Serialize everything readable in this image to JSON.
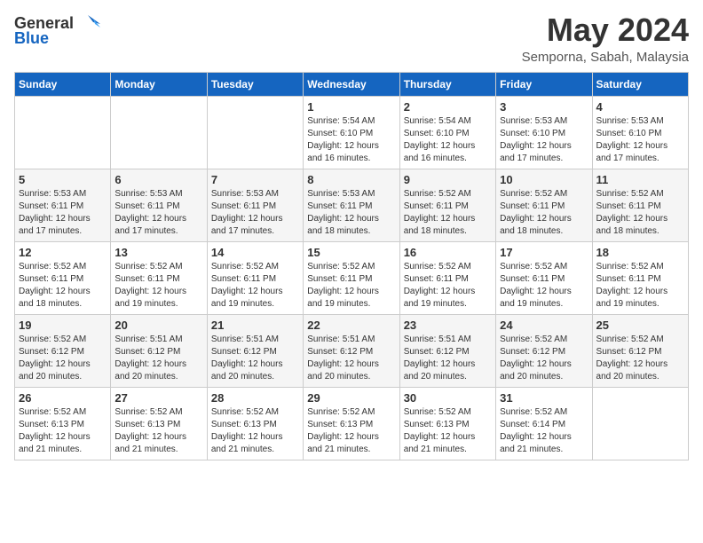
{
  "logo": {
    "general": "General",
    "blue": "Blue"
  },
  "header": {
    "month": "May 2024",
    "location": "Semporna, Sabah, Malaysia"
  },
  "weekdays": [
    "Sunday",
    "Monday",
    "Tuesday",
    "Wednesday",
    "Thursday",
    "Friday",
    "Saturday"
  ],
  "weeks": [
    [
      {
        "day": "",
        "info": ""
      },
      {
        "day": "",
        "info": ""
      },
      {
        "day": "",
        "info": ""
      },
      {
        "day": "1",
        "info": "Sunrise: 5:54 AM\nSunset: 6:10 PM\nDaylight: 12 hours and 16 minutes."
      },
      {
        "day": "2",
        "info": "Sunrise: 5:54 AM\nSunset: 6:10 PM\nDaylight: 12 hours and 16 minutes."
      },
      {
        "day": "3",
        "info": "Sunrise: 5:53 AM\nSunset: 6:10 PM\nDaylight: 12 hours and 17 minutes."
      },
      {
        "day": "4",
        "info": "Sunrise: 5:53 AM\nSunset: 6:10 PM\nDaylight: 12 hours and 17 minutes."
      }
    ],
    [
      {
        "day": "5",
        "info": "Sunrise: 5:53 AM\nSunset: 6:11 PM\nDaylight: 12 hours and 17 minutes."
      },
      {
        "day": "6",
        "info": "Sunrise: 5:53 AM\nSunset: 6:11 PM\nDaylight: 12 hours and 17 minutes."
      },
      {
        "day": "7",
        "info": "Sunrise: 5:53 AM\nSunset: 6:11 PM\nDaylight: 12 hours and 17 minutes."
      },
      {
        "day": "8",
        "info": "Sunrise: 5:53 AM\nSunset: 6:11 PM\nDaylight: 12 hours and 18 minutes."
      },
      {
        "day": "9",
        "info": "Sunrise: 5:52 AM\nSunset: 6:11 PM\nDaylight: 12 hours and 18 minutes."
      },
      {
        "day": "10",
        "info": "Sunrise: 5:52 AM\nSunset: 6:11 PM\nDaylight: 12 hours and 18 minutes."
      },
      {
        "day": "11",
        "info": "Sunrise: 5:52 AM\nSunset: 6:11 PM\nDaylight: 12 hours and 18 minutes."
      }
    ],
    [
      {
        "day": "12",
        "info": "Sunrise: 5:52 AM\nSunset: 6:11 PM\nDaylight: 12 hours and 18 minutes."
      },
      {
        "day": "13",
        "info": "Sunrise: 5:52 AM\nSunset: 6:11 PM\nDaylight: 12 hours and 19 minutes."
      },
      {
        "day": "14",
        "info": "Sunrise: 5:52 AM\nSunset: 6:11 PM\nDaylight: 12 hours and 19 minutes."
      },
      {
        "day": "15",
        "info": "Sunrise: 5:52 AM\nSunset: 6:11 PM\nDaylight: 12 hours and 19 minutes."
      },
      {
        "day": "16",
        "info": "Sunrise: 5:52 AM\nSunset: 6:11 PM\nDaylight: 12 hours and 19 minutes."
      },
      {
        "day": "17",
        "info": "Sunrise: 5:52 AM\nSunset: 6:11 PM\nDaylight: 12 hours and 19 minutes."
      },
      {
        "day": "18",
        "info": "Sunrise: 5:52 AM\nSunset: 6:11 PM\nDaylight: 12 hours and 19 minutes."
      }
    ],
    [
      {
        "day": "19",
        "info": "Sunrise: 5:52 AM\nSunset: 6:12 PM\nDaylight: 12 hours and 20 minutes."
      },
      {
        "day": "20",
        "info": "Sunrise: 5:51 AM\nSunset: 6:12 PM\nDaylight: 12 hours and 20 minutes."
      },
      {
        "day": "21",
        "info": "Sunrise: 5:51 AM\nSunset: 6:12 PM\nDaylight: 12 hours and 20 minutes."
      },
      {
        "day": "22",
        "info": "Sunrise: 5:51 AM\nSunset: 6:12 PM\nDaylight: 12 hours and 20 minutes."
      },
      {
        "day": "23",
        "info": "Sunrise: 5:51 AM\nSunset: 6:12 PM\nDaylight: 12 hours and 20 minutes."
      },
      {
        "day": "24",
        "info": "Sunrise: 5:52 AM\nSunset: 6:12 PM\nDaylight: 12 hours and 20 minutes."
      },
      {
        "day": "25",
        "info": "Sunrise: 5:52 AM\nSunset: 6:12 PM\nDaylight: 12 hours and 20 minutes."
      }
    ],
    [
      {
        "day": "26",
        "info": "Sunrise: 5:52 AM\nSunset: 6:13 PM\nDaylight: 12 hours and 21 minutes."
      },
      {
        "day": "27",
        "info": "Sunrise: 5:52 AM\nSunset: 6:13 PM\nDaylight: 12 hours and 21 minutes."
      },
      {
        "day": "28",
        "info": "Sunrise: 5:52 AM\nSunset: 6:13 PM\nDaylight: 12 hours and 21 minutes."
      },
      {
        "day": "29",
        "info": "Sunrise: 5:52 AM\nSunset: 6:13 PM\nDaylight: 12 hours and 21 minutes."
      },
      {
        "day": "30",
        "info": "Sunrise: 5:52 AM\nSunset: 6:13 PM\nDaylight: 12 hours and 21 minutes."
      },
      {
        "day": "31",
        "info": "Sunrise: 5:52 AM\nSunset: 6:14 PM\nDaylight: 12 hours and 21 minutes."
      },
      {
        "day": "",
        "info": ""
      }
    ]
  ]
}
